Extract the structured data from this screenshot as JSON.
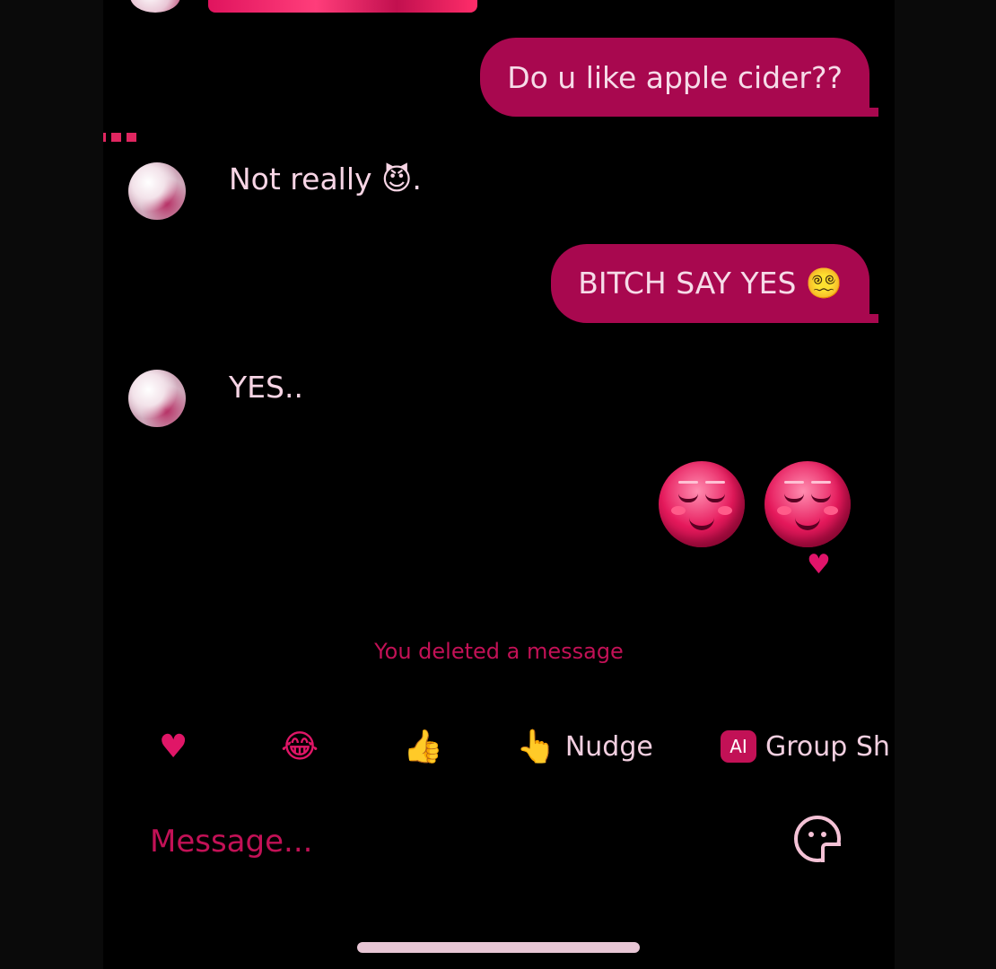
{
  "messages": {
    "outgoing_1": "Do u like apple cider??",
    "incoming_1": "Not really 😈.",
    "outgoing_2": "BITCH SAY YES 😵‍💫",
    "incoming_2": "YES..",
    "system_notice": "You deleted a message"
  },
  "reaction": "♥",
  "quick_replies": {
    "heart": "♥",
    "laugh": "😂",
    "thumb": "👍",
    "nudge_icon": "👆",
    "nudge_label": "Nudge",
    "ai_badge": "AI",
    "group_label": "Group Sh"
  },
  "composer": {
    "placeholder": "Message..."
  },
  "colors": {
    "accent": "#c21156",
    "bubble": "#a8084f"
  }
}
